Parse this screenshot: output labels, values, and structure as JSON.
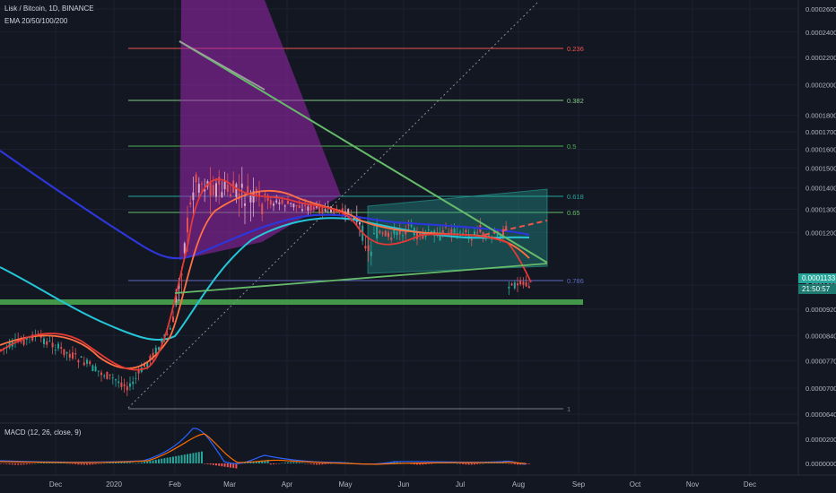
{
  "header": {
    "symbol_line": "Lisk / Bitcoin, 1D, BINANCE",
    "indicator_line": "EMA 20/50/100/200"
  },
  "macd": {
    "label": "MACD (12, 26, close, 9)"
  },
  "price_tag": {
    "price": "0.0001133",
    "countdown": "21:50:57"
  },
  "colors": {
    "background": "#131722",
    "grid": "#1c2030",
    "up_candle": "#d9a7c7",
    "down_candle": "#e05252",
    "price_tag": "#26a69a",
    "support_zone": "#4caf50",
    "triangle": "#9c27b0",
    "channel": "#26a69a"
  },
  "chart_data": {
    "type": "candlestick",
    "title": "Lisk / Bitcoin, 1D, BINANCE",
    "x_ticks": [
      "Dec",
      "2020",
      "Feb",
      "Mar",
      "Apr",
      "May",
      "Jun",
      "Jul",
      "Aug",
      "Sep",
      "Oct",
      "Nov",
      "Dec"
    ],
    "y_ticks": [
      "0.0002600",
      "0.0002400",
      "0.0002200",
      "0.0002000",
      "0.0001800",
      "0.0001700",
      "0.0001600",
      "0.0001500",
      "0.0001400",
      "0.0001300",
      "0.0001200",
      "0.0001000",
      "0.0000920",
      "0.0000840",
      "0.0000770",
      "0.0000700",
      "0.0000640"
    ],
    "macd_y_ticks": [
      "0.0000200",
      "0.0000000"
    ],
    "log_scale": true,
    "fib_levels": [
      {
        "label": "0.236",
        "value": 0.000233
      },
      {
        "label": "0.382",
        "value": 0.000201
      },
      {
        "label": "0.5",
        "value": 0.000178
      },
      {
        "label": "0.618",
        "value": 0.000152
      },
      {
        "label": "0.65",
        "value": 0.000144
      },
      {
        "label": "0.786",
        "value": 0.000115
      },
      {
        "label": "1",
        "value": 6.3e-05
      }
    ],
    "ema_series": [
      {
        "name": "EMA 20",
        "color": "#e53935"
      },
      {
        "name": "EMA 50",
        "color": "#ff7043"
      },
      {
        "name": "EMA 100",
        "color": "#26c6da"
      },
      {
        "name": "EMA 200",
        "color": "#2d36d8"
      }
    ],
    "last_price": 0.0001133
  }
}
